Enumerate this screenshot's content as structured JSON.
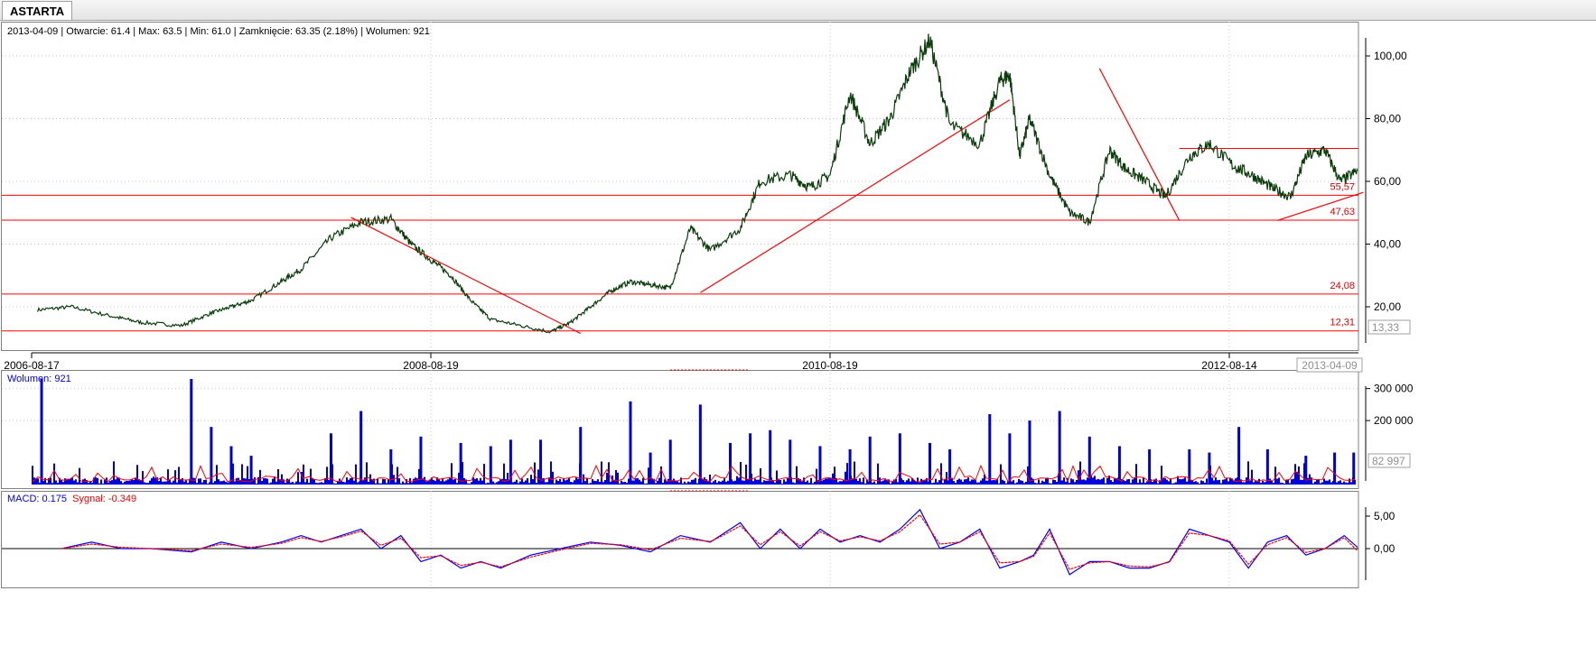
{
  "tab": {
    "label": "ASTARTA"
  },
  "info": {
    "date": "2013-04-09",
    "open": "Otwarcie: 61.4",
    "max": "Max: 63.5",
    "min": "Min: 61.0",
    "close": "Zamknięcie: 63.35 (2.18%)",
    "volume": "Wolumen: 921"
  },
  "colors": {
    "price": "#0a3d0a",
    "support": "#ff0000",
    "volume": "#0000dd",
    "volume_avg": "#ff0000",
    "macd": "#0000ff",
    "signal": "#ff0000",
    "grid": "#c8c8c8"
  },
  "chart_data": [
    {
      "type": "line",
      "panel": "price",
      "x_ticks": [
        "2006-08-17",
        "2008-08-19",
        "2010-08-19",
        "2012-08-14"
      ],
      "last_date": "2013-04-09",
      "ylim": [
        10,
        107
      ],
      "y_ticks": [
        "100,00",
        "80,00",
        "60,00",
        "40,00",
        "20,00"
      ],
      "y_tick_values": [
        100,
        80,
        60,
        40,
        20
      ],
      "current_value_label": "13,33",
      "grid": true,
      "series": [
        {
          "x": [
            2006.63,
            2006.8,
            2007.0,
            2007.15,
            2007.35,
            2007.5,
            2007.6,
            2007.7,
            2007.85,
            2007.95,
            2008.1,
            2008.25,
            2008.4,
            2008.5,
            2008.6,
            2008.7,
            2008.8,
            2008.9,
            2009.05,
            2009.2,
            2009.3,
            2009.4,
            2009.5,
            2009.6,
            2009.7,
            2009.8,
            2009.9,
            2010.0,
            2010.15,
            2010.25,
            2010.4,
            2010.5,
            2010.6,
            2010.7,
            2010.8,
            2010.9,
            2011.0,
            2011.1,
            2011.2,
            2011.35,
            2011.45,
            2011.5,
            2011.55,
            2011.6,
            2011.7,
            2011.8,
            2011.9,
            2012.0,
            2012.08,
            2012.18,
            2012.28,
            2012.4,
            2012.5,
            2012.62,
            2012.72,
            2012.82,
            2012.92,
            2013.0,
            2013.1,
            2013.18,
            2013.27
          ],
          "y": [
            19,
            20,
            17,
            15,
            14,
            18,
            20,
            22,
            28,
            32,
            42,
            47,
            48,
            40,
            35,
            30,
            22,
            16,
            14,
            12,
            15,
            20,
            25,
            28,
            27,
            26,
            45,
            38,
            45,
            60,
            62,
            58,
            62,
            88,
            72,
            80,
            95,
            105,
            78,
            72,
            92,
            94,
            68,
            80,
            62,
            50,
            47,
            70,
            64,
            60,
            55,
            68,
            72,
            65,
            62,
            58,
            55,
            68,
            70,
            60,
            63.35
          ]
        }
      ],
      "levels": [
        {
          "value": 55.57,
          "label": "55,57"
        },
        {
          "value": 47.63,
          "label": "47,63"
        },
        {
          "value": 24.08,
          "label": "24,08"
        },
        {
          "value": 12.31,
          "label": "12,31"
        }
      ],
      "trend_lines": [
        {
          "x": [
            2008.2,
            2009.35
          ],
          "y": [
            48.5,
            11.5
          ]
        },
        {
          "x": [
            2009.95,
            2011.5
          ],
          "y": [
            24.5,
            86
          ]
        },
        {
          "x": [
            2011.95,
            2012.35
          ],
          "y": [
            96,
            47.5
          ]
        },
        {
          "x": [
            2012.85,
            2013.3
          ],
          "y": [
            47.5,
            56.5
          ]
        }
      ],
      "resistance_segment": {
        "x": [
          2012.35,
          2013.3
        ],
        "y": 70.5
      }
    },
    {
      "type": "bar",
      "panel": "volume",
      "label": "Wolumen: 921",
      "y_ticks": [
        "300 000",
        "200 000"
      ],
      "y_tick_values": [
        300000,
        200000
      ],
      "ylim": [
        0,
        330000
      ],
      "current_value_label": "82 997",
      "grid": true,
      "spikes": {
        "x": [
          2006.65,
          2007.4,
          2007.5,
          2007.6,
          2007.7,
          2008.1,
          2008.25,
          2008.4,
          2008.55,
          2008.75,
          2008.9,
          2009.0,
          2009.15,
          2009.35,
          2009.6,
          2009.7,
          2009.8,
          2009.95,
          2010.1,
          2010.2,
          2010.3,
          2010.4,
          2010.55,
          2010.7,
          2010.8,
          2010.95,
          2011.1,
          2011.2,
          2011.4,
          2011.5,
          2011.6,
          2011.75,
          2011.9,
          2012.05,
          2012.2,
          2012.4,
          2012.5,
          2012.65,
          2012.8,
          2013.0,
          2013.15,
          2013.25
        ],
        "y": [
          340000,
          330000,
          180000,
          120000,
          90000,
          160000,
          230000,
          110000,
          150000,
          130000,
          120000,
          140000,
          140000,
          180000,
          260000,
          100000,
          140000,
          250000,
          130000,
          160000,
          170000,
          140000,
          120000,
          110000,
          150000,
          160000,
          130000,
          110000,
          220000,
          160000,
          200000,
          230000,
          150000,
          120000,
          110000,
          110000,
          100000,
          180000,
          110000,
          90000,
          100000,
          100000
        ]
      }
    },
    {
      "type": "line",
      "panel": "macd",
      "label_macd": "MACD: 0.175",
      "label_signal": "Sygnał: -0.349",
      "y_ticks": [
        "5,00",
        "0,00"
      ],
      "y_tick_values": [
        5,
        0
      ],
      "ylim": [
        -7,
        9
      ],
      "grid": true,
      "series": [
        {
          "name": "MACD: 0.175",
          "x": [
            2006.75,
            2006.9,
            2007.05,
            2007.2,
            2007.4,
            2007.55,
            2007.7,
            2007.85,
            2007.95,
            2008.05,
            2008.15,
            2008.25,
            2008.35,
            2008.45,
            2008.55,
            2008.65,
            2008.75,
            2008.85,
            2008.95,
            2009.1,
            2009.25,
            2009.4,
            2009.55,
            2009.7,
            2009.85,
            2010.0,
            2010.05,
            2010.15,
            2010.25,
            2010.35,
            2010.45,
            2010.55,
            2010.65,
            2010.75,
            2010.85,
            2010.95,
            2011.05,
            2011.15,
            2011.25,
            2011.35,
            2011.45,
            2011.55,
            2011.62,
            2011.7,
            2011.8,
            2011.9,
            2012.0,
            2012.1,
            2012.2,
            2012.3,
            2012.4,
            2012.5,
            2012.6,
            2012.7,
            2012.8,
            2012.9,
            2013.0,
            2013.1,
            2013.2,
            2013.27
          ],
          "y": [
            0,
            1,
            0,
            0,
            -0.5,
            1,
            0,
            1,
            2,
            1,
            2,
            3,
            0,
            2,
            -2,
            -1,
            -3,
            -2,
            -3,
            -1,
            0,
            1,
            0.5,
            -0.5,
            2,
            1,
            2,
            4,
            0,
            3,
            0,
            3,
            1,
            2,
            1,
            3,
            6,
            0,
            1,
            3,
            -3,
            -2,
            -1,
            3,
            -4,
            -2,
            -2,
            -3,
            -3,
            -2,
            3,
            2,
            1,
            -3,
            1,
            2,
            -1,
            0,
            2,
            0.2
          ]
        },
        {
          "name": "Sygnał: -0.349",
          "x": [
            2006.75,
            2006.9,
            2007.05,
            2007.2,
            2007.4,
            2007.55,
            2007.7,
            2007.85,
            2007.95,
            2008.05,
            2008.15,
            2008.25,
            2008.35,
            2008.45,
            2008.55,
            2008.65,
            2008.75,
            2008.85,
            2008.95,
            2009.1,
            2009.25,
            2009.4,
            2009.55,
            2009.7,
            2009.85,
            2010.0,
            2010.05,
            2010.15,
            2010.25,
            2010.35,
            2010.45,
            2010.55,
            2010.65,
            2010.75,
            2010.85,
            2010.95,
            2011.05,
            2011.15,
            2011.25,
            2011.35,
            2011.45,
            2011.55,
            2011.62,
            2011.7,
            2011.8,
            2011.9,
            2012.0,
            2012.1,
            2012.2,
            2012.3,
            2012.4,
            2012.5,
            2012.6,
            2012.7,
            2012.8,
            2012.9,
            2013.0,
            2013.1,
            2013.2,
            2013.27
          ],
          "y": [
            0,
            0.7,
            0.2,
            0,
            -0.3,
            0.7,
            0.2,
            0.8,
            1.7,
            1.1,
            1.8,
            2.7,
            0.5,
            1.6,
            -1.4,
            -1.1,
            -2.6,
            -2.1,
            -2.8,
            -1.3,
            -0.2,
            0.8,
            0.6,
            -0.2,
            1.6,
            1.1,
            1.8,
            3.5,
            0.6,
            2.6,
            0.4,
            2.6,
            1.2,
            1.8,
            1.2,
            2.6,
            5.2,
            0.7,
            1.0,
            2.6,
            -2.2,
            -2.0,
            -1.2,
            2.4,
            -3.2,
            -2.2,
            -2.0,
            -2.7,
            -2.8,
            -2.1,
            2.4,
            2.0,
            1.2,
            -2.4,
            0.6,
            1.7,
            -0.6,
            0,
            1.7,
            -0.35
          ]
        }
      ]
    }
  ]
}
